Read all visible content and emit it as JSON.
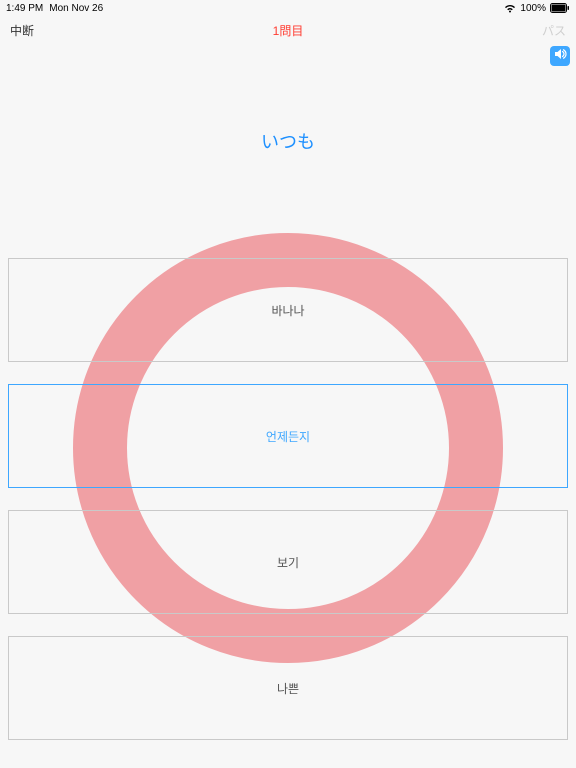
{
  "status": {
    "time": "1:49 PM",
    "date": "Mon Nov 26",
    "battery_pct": "100%"
  },
  "nav": {
    "left": "中断",
    "title": "1問目",
    "right": "パス"
  },
  "question": {
    "text": "いつも"
  },
  "options": [
    {
      "label": "바나나",
      "selected": false
    },
    {
      "label": "언제든지",
      "selected": true
    },
    {
      "label": "보기",
      "selected": false
    },
    {
      "label": "나쁜",
      "selected": false
    }
  ]
}
